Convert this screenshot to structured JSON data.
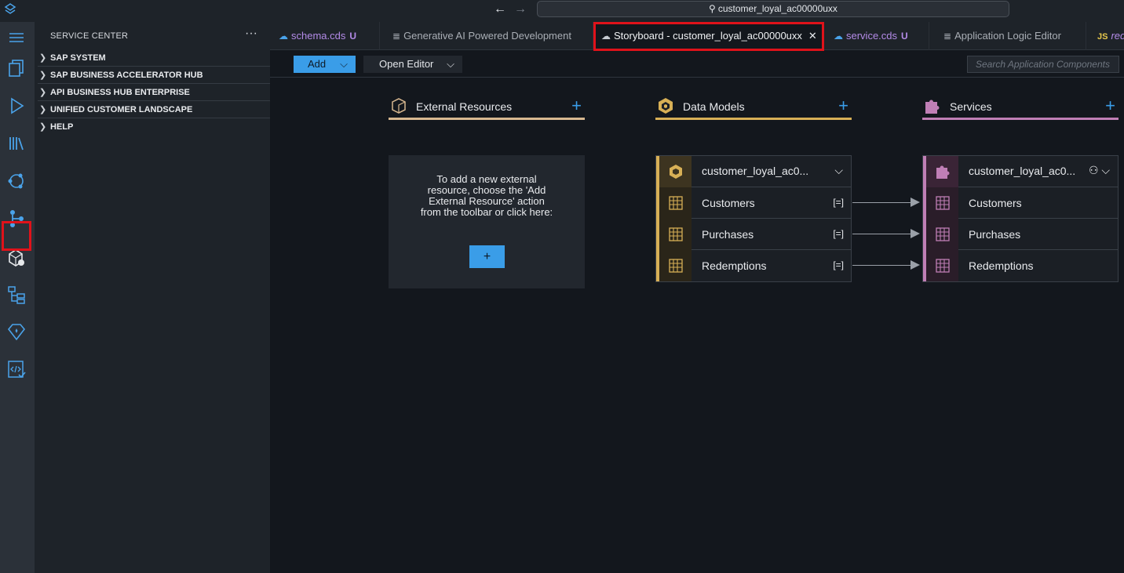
{
  "titlebar": {
    "command_center_text": "customer_loyal_ac00000uxx"
  },
  "activity_bar": {
    "icons": [
      "menu-icon",
      "explorer-icon",
      "run-icon",
      "library-icon",
      "cloud-icon",
      "source-control-icon",
      "storyboard-icon",
      "tree-icon",
      "gem-icon",
      "code-check-icon"
    ]
  },
  "sidebar": {
    "title": "SERVICE CENTER",
    "more": "···",
    "items": [
      {
        "label": "SAP SYSTEM"
      },
      {
        "label": "SAP BUSINESS ACCELERATOR HUB"
      },
      {
        "label": "API BUSINESS HUB ENTERPRISE"
      },
      {
        "label": "UNIFIED CUSTOMER LANDSCAPE"
      },
      {
        "label": "HELP"
      }
    ]
  },
  "tabs": [
    {
      "label": "schema.cds",
      "badge": "U"
    },
    {
      "label": "Generative AI Powered Development"
    },
    {
      "label": "Storyboard - customer_loyal_ac00000uxx",
      "close": "✕"
    },
    {
      "label": "service.cds",
      "badge": "U"
    },
    {
      "label": "Application Logic Editor"
    },
    {
      "label": "red",
      "prefix": "JS"
    }
  ],
  "toolbar": {
    "add_label": "Add",
    "open_editor_label": "Open Editor",
    "search_placeholder": "Search Application Components"
  },
  "columns": {
    "external": {
      "title": "External Resources",
      "plus": "+"
    },
    "data_models": {
      "title": "Data Models",
      "plus": "+"
    },
    "services": {
      "title": "Services",
      "plus": "+"
    }
  },
  "external_panel": {
    "text": "To add a new external resource, choose the 'Add External Resource' action from the toolbar or click here:",
    "button": "+"
  },
  "data_model_card": {
    "title": "customer_loyal_ac0...",
    "rows": [
      {
        "label": "Customers",
        "entity": "[=]"
      },
      {
        "label": "Purchases",
        "entity": "[=]"
      },
      {
        "label": "Redemptions",
        "entity": "[=]"
      }
    ]
  },
  "service_card": {
    "title": "customer_loyal_ac0...",
    "rows": [
      {
        "label": "Customers"
      },
      {
        "label": "Purchases"
      },
      {
        "label": "Redemptions"
      }
    ]
  },
  "colors": {
    "accent": "#3a9de8",
    "data_model": "#d8b056",
    "service": "#c07fb6",
    "highlight": "#e0121a"
  }
}
